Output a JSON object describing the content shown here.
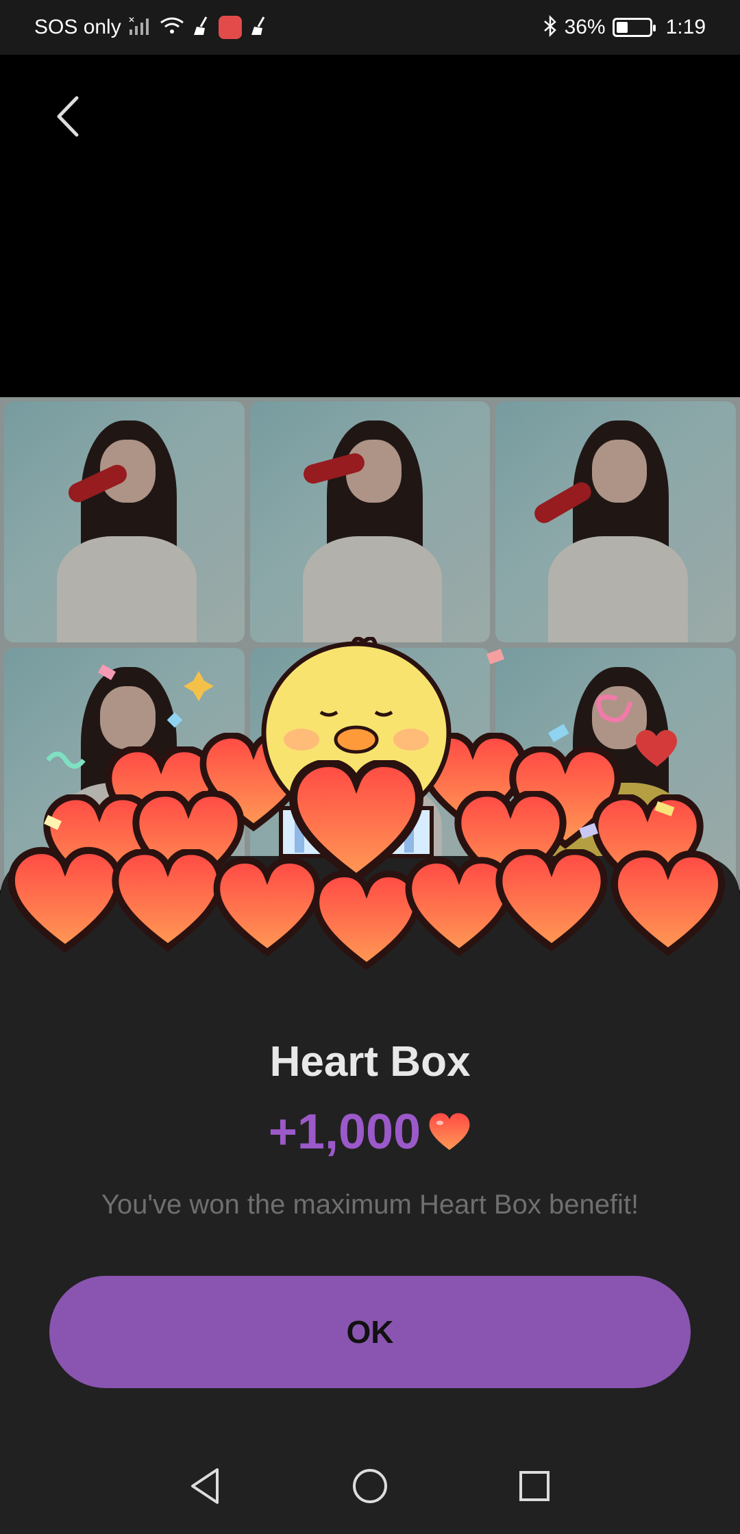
{
  "status_bar": {
    "carrier": "SOS only",
    "battery": "36%",
    "time": "1:19",
    "battery_level": 0.36,
    "icons": [
      "no-signal-icon",
      "wifi-icon",
      "broom-icon",
      "app-store-icon",
      "broom-icon",
      "bluetooth-icon",
      "battery-icon"
    ]
  },
  "header": {
    "back_icon": "chevron-left-icon"
  },
  "dialog": {
    "title": "Heart Box",
    "reward": "+1,000",
    "reward_icon": "heart-icon",
    "message": "You've won the maximum Heart Box benefit!",
    "ok_label": "OK",
    "accent_color": "#8a55b0",
    "reward_color": "#9b59c9"
  },
  "nav": {
    "back": "back-triangle-icon",
    "home": "home-circle-icon",
    "recents": "recents-square-icon"
  }
}
